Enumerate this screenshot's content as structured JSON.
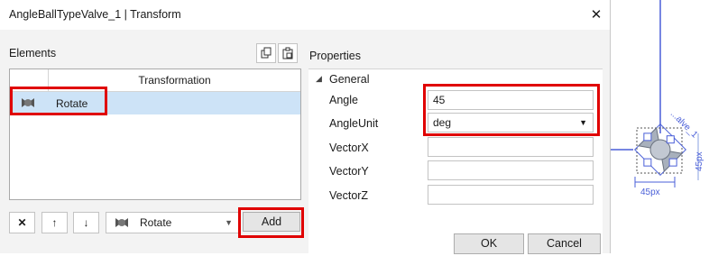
{
  "window": {
    "title": "AngleBallTypeValve_1 | Transform",
    "close_glyph": "✕"
  },
  "elements_panel": {
    "label": "Elements",
    "column_header": "Transformation",
    "rows": [
      {
        "label": "Rotate",
        "icon": "rotate-icon"
      }
    ]
  },
  "toolbar": {
    "delete_glyph": "✕",
    "up_glyph": "↑",
    "down_glyph": "↓",
    "type_select": {
      "value": "Rotate",
      "icon": "rotate-icon"
    },
    "add_label": "Add"
  },
  "properties": {
    "label": "Properties",
    "group": "General",
    "fields": [
      {
        "label": "Angle",
        "value": "45"
      },
      {
        "label": "AngleUnit",
        "value": "deg"
      },
      {
        "label": "VectorX",
        "value": ""
      },
      {
        "label": "VectorY",
        "value": ""
      },
      {
        "label": "VectorZ",
        "value": ""
      }
    ]
  },
  "footer": {
    "ok_label": "OK",
    "cancel_label": "Cancel"
  },
  "canvas": {
    "shape_label": "...alve_1",
    "width_label": "45px",
    "height_label": "45px"
  },
  "colors": {
    "highlight": "#e00000",
    "selection": "#cde3f7",
    "accent": "#4a5fd8"
  }
}
